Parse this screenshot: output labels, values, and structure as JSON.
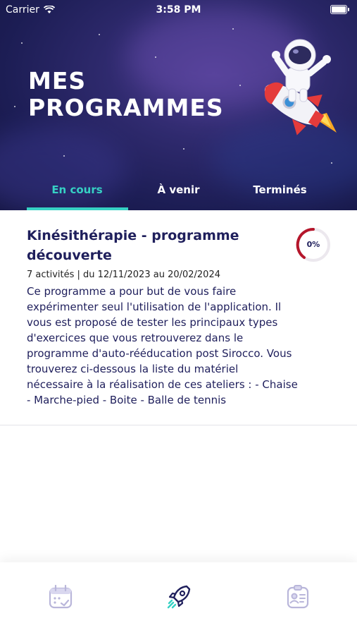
{
  "status_bar": {
    "carrier": "Carrier",
    "time": "3:58 PM"
  },
  "header": {
    "title_line1": "MES",
    "title_line2": "PROGRAMMES"
  },
  "tabs": [
    {
      "label": "En cours",
      "active": true
    },
    {
      "label": "À venir",
      "active": false
    },
    {
      "label": "Terminés",
      "active": false
    }
  ],
  "program": {
    "title": "Kinésithérapie - programme découverte",
    "meta": "7 activités | du 12/11/2023 au 20/02/2024",
    "description": "Ce programme a pour but de vous faire expérimenter seul l'utilisation de l'application. Il vous est proposé de tester les principaux types d'exercices que vous retrouverez dans le programme d'auto-rééducation post Sirocco. Vous trouverez ci-dessous la liste du matériel nécessaire à la réalisation de ces ateliers : - Chaise - Marche-pied - Boite - Balle de tennis",
    "progress_label": "0%",
    "progress_value": 0
  },
  "bottom_nav": [
    {
      "icon": "calendar-check-icon",
      "active": false
    },
    {
      "icon": "rocket-icon",
      "active": true
    },
    {
      "icon": "id-card-icon",
      "active": false
    }
  ],
  "colors": {
    "accent": "#36d1c4",
    "navy": "#1f1f5c",
    "progress_red": "#b5162b"
  }
}
